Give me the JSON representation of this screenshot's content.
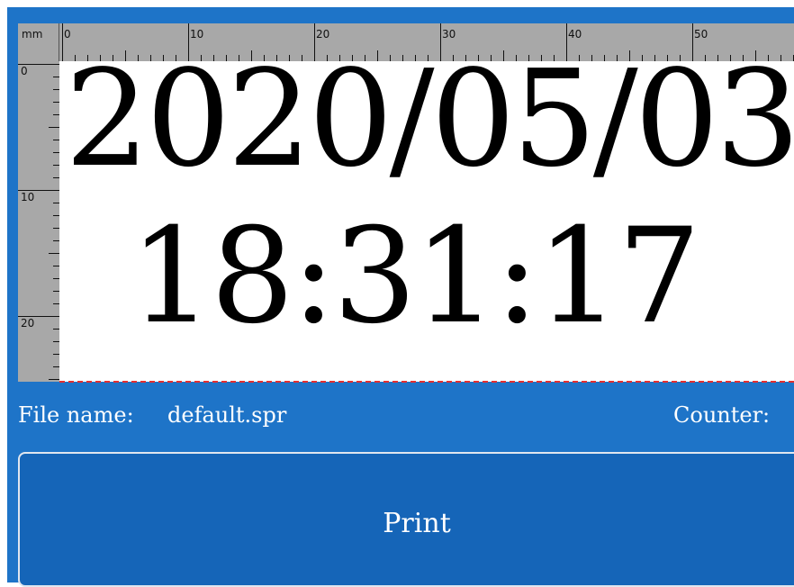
{
  "ruler": {
    "unit": "mm",
    "h_labels": [
      "0",
      "10",
      "20",
      "30",
      "40",
      "50"
    ],
    "v_labels": [
      "0",
      "10",
      "20"
    ]
  },
  "canvas": {
    "line1": "2020/05/03",
    "line2": "18:31:17"
  },
  "status": {
    "file_label": "File name:",
    "file_value": "default.spr",
    "counter_label": "Counter:"
  },
  "actions": {
    "print_label": "Print"
  },
  "colors": {
    "background": "#1e74c8",
    "button": "#1565b8",
    "ruler": "#a8a8a8",
    "limit_line": "#e53030"
  }
}
